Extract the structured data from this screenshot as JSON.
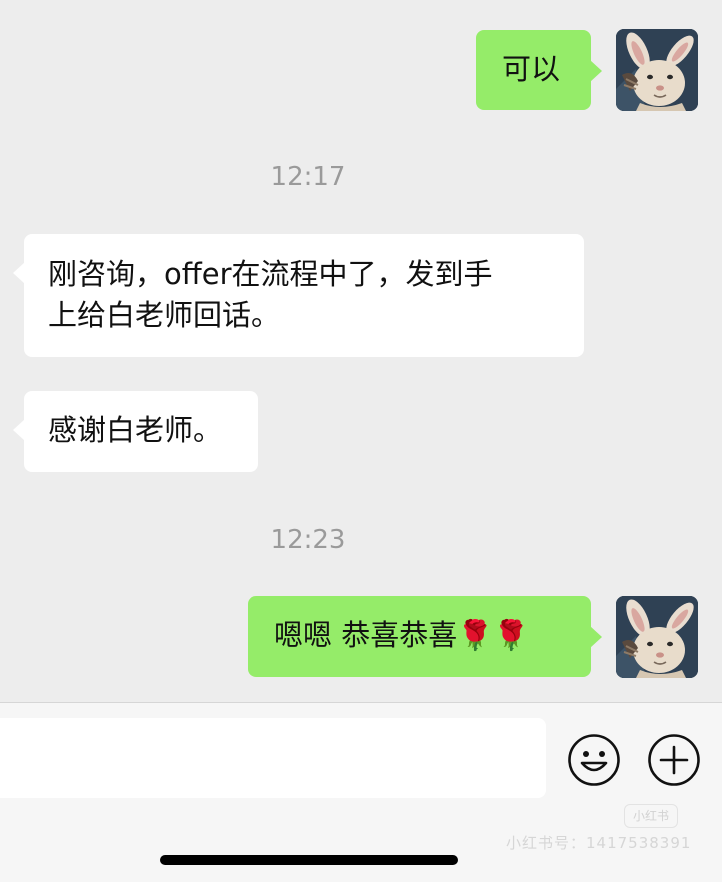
{
  "messages": [
    {
      "type": "outgoing",
      "text": "可以"
    },
    {
      "type": "time",
      "text": "12:17"
    },
    {
      "type": "incoming",
      "line1": "刚咨询，offer在流程中了，发到手",
      "line2": "上给白老师回话。"
    },
    {
      "type": "incoming",
      "text": "感谢白老师。"
    },
    {
      "type": "time",
      "text": "12:23"
    },
    {
      "type": "outgoing",
      "text": "嗯嗯 恭喜恭喜🌹🌹"
    }
  ],
  "input": {
    "value": "",
    "placeholder": ""
  },
  "toolbar": {
    "emoji_icon": "smiley-icon",
    "add_icon": "plus-icon"
  },
  "watermark": {
    "logo": "小红书",
    "id": "小红书号：1417538391"
  },
  "colors": {
    "outgoing_bubble": "#95ec69",
    "incoming_bubble": "#ffffff",
    "background": "#ededed"
  }
}
